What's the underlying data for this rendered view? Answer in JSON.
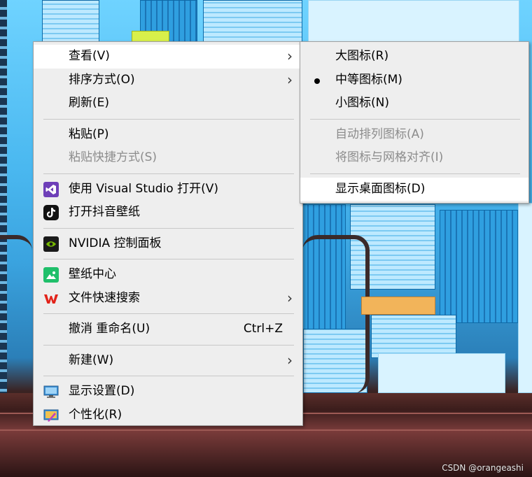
{
  "main_menu": {
    "items": [
      {
        "label": "查看(V)",
        "has_submenu": true
      },
      {
        "label": "排序方式(O)",
        "has_submenu": true
      },
      {
        "label": "刷新(E)"
      },
      {
        "label": "粘贴(P)"
      },
      {
        "label": "粘贴快捷方式(S)",
        "disabled": true
      },
      {
        "label": "使用 Visual Studio 打开(V)",
        "icon": "visual-studio-icon"
      },
      {
        "label": "打开抖音壁纸",
        "icon": "tiktok-icon"
      },
      {
        "label": "NVIDIA 控制面板",
        "icon": "nvidia-icon"
      },
      {
        "label": "壁纸中心",
        "icon": "wallpaper-icon"
      },
      {
        "label": "文件快速搜索",
        "icon": "wps-icon",
        "has_submenu": true
      },
      {
        "label": "撤消 重命名(U)",
        "shortcut": "Ctrl+Z"
      },
      {
        "label": "新建(W)",
        "has_submenu": true
      },
      {
        "label": "显示设置(D)",
        "icon": "display-icon"
      },
      {
        "label": "个性化(R)",
        "icon": "personalize-icon"
      }
    ]
  },
  "view_submenu": {
    "items": [
      {
        "label": "大图标(R)"
      },
      {
        "label": "中等图标(M)",
        "selected": true
      },
      {
        "label": "小图标(N)"
      },
      {
        "label": "自动排列图标(A)",
        "disabled": true
      },
      {
        "label": "将图标与网格对齐(I)",
        "disabled": true
      },
      {
        "label": "显示桌面图标(D)"
      }
    ]
  },
  "watermark": "CSDN @orangeashi",
  "colors": {
    "menu_bg": "#eeeeee",
    "hover_bg": "#ffffff",
    "disabled_text": "#8c8c8c"
  }
}
